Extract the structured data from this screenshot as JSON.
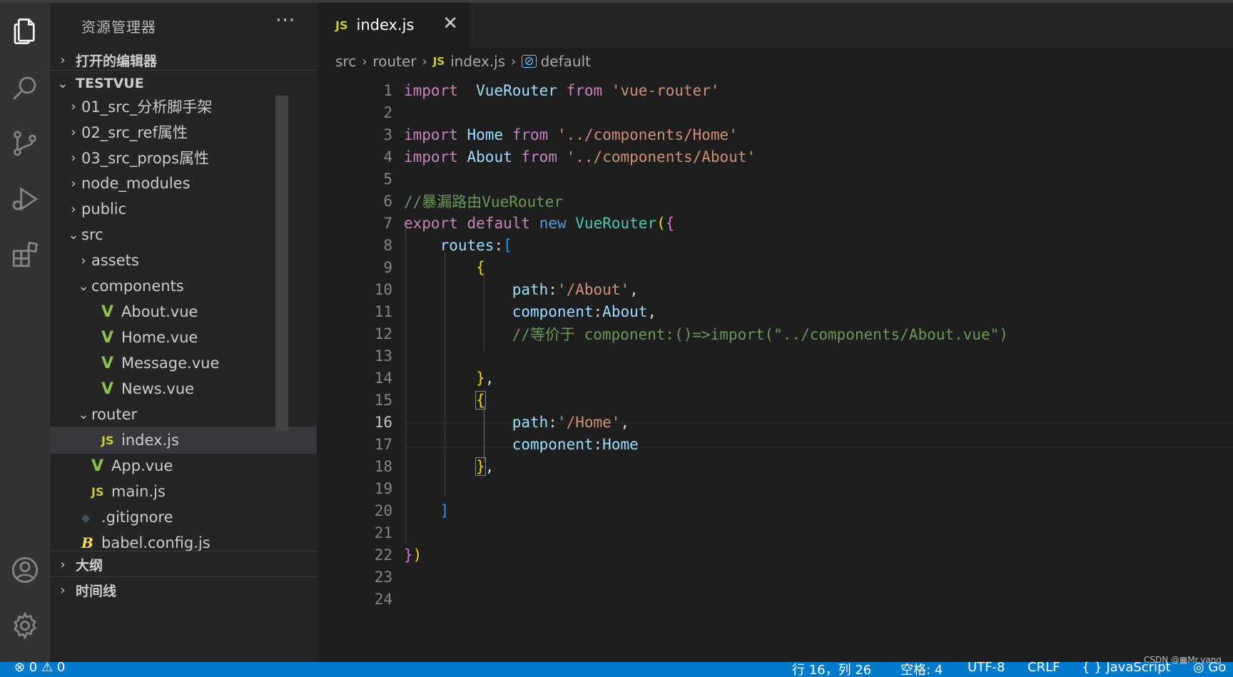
{
  "activity_bar": {
    "items": [
      "explorer-icon",
      "search-icon",
      "source-control-icon",
      "run-debug-icon",
      "extensions-icon"
    ],
    "bottom": [
      "account-icon",
      "settings-gear-icon"
    ]
  },
  "sidebar": {
    "title": "资源管理器",
    "more": "···",
    "open_editors": "打开的编辑器",
    "workspace": "TESTVUE",
    "tree": [
      {
        "label": "01_src_分析脚手架",
        "chev": "›",
        "icon": "",
        "depth": 0
      },
      {
        "label": "02_src_ref属性",
        "chev": "›",
        "icon": "",
        "depth": 0
      },
      {
        "label": "03_src_props属性",
        "chev": "›",
        "icon": "",
        "depth": 0
      },
      {
        "label": "node_modules",
        "chev": "›",
        "icon": "",
        "depth": 0
      },
      {
        "label": "public",
        "chev": "›",
        "icon": "",
        "depth": 0
      },
      {
        "label": "src",
        "chev": "⌄",
        "icon": "",
        "depth": 0
      },
      {
        "label": "assets",
        "chev": "›",
        "icon": "",
        "depth": 1
      },
      {
        "label": "components",
        "chev": "⌄",
        "icon": "",
        "depth": 1
      },
      {
        "label": "About.vue",
        "chev": "",
        "icon": "vue",
        "depth": 2
      },
      {
        "label": "Home.vue",
        "chev": "",
        "icon": "vue",
        "depth": 2
      },
      {
        "label": "Message.vue",
        "chev": "",
        "icon": "vue",
        "depth": 2
      },
      {
        "label": "News.vue",
        "chev": "",
        "icon": "vue",
        "depth": 2
      },
      {
        "label": "router",
        "chev": "⌄",
        "icon": "",
        "depth": 1
      },
      {
        "label": "index.js",
        "chev": "",
        "icon": "js",
        "depth": 2
      },
      {
        "label": "App.vue",
        "chev": "",
        "icon": "vue",
        "depth": 1
      },
      {
        "label": "main.js",
        "chev": "",
        "icon": "js",
        "depth": 1
      },
      {
        "label": ".gitignore",
        "chev": "",
        "icon": "git",
        "depth": 0
      },
      {
        "label": "babel.config.js",
        "chev": "",
        "icon": "babel",
        "depth": 0
      }
    ],
    "outline": "大纲",
    "timeline": "时间线",
    "icon_text": {
      "js": "JS",
      "vue": "V",
      "git": "◆",
      "babel": "B"
    }
  },
  "editor": {
    "tab": {
      "icon": "JS",
      "name": "index.js",
      "close": "✕"
    },
    "breadcrumb": {
      "src": "src",
      "router": "router",
      "js_icon": "JS",
      "file": "index.js",
      "symbol_icon": "⊘",
      "symbol": "default"
    },
    "lines": [
      "1",
      "2",
      "3",
      "4",
      "5",
      "6",
      "7",
      "8",
      "9",
      "10",
      "11",
      "12",
      "13",
      "14",
      "15",
      "16",
      "17",
      "18",
      "19",
      "20",
      "21",
      "22",
      "23",
      "24"
    ],
    "current_line": "16",
    "code": {
      "l1": [
        "import",
        "VueRouter",
        "from",
        "'vue-router'"
      ],
      "l3": [
        "import",
        "Home",
        "from",
        "'../components/Home'"
      ],
      "l4": [
        "import",
        "About",
        "from",
        "'../components/About'"
      ],
      "l6": "//暴漏路由VueRouter",
      "l7": [
        "export",
        "default",
        "new",
        "VueRouter",
        "(",
        "{"
      ],
      "l8": [
        "routes",
        ":",
        "["
      ],
      "l9": "{",
      "l10": [
        "path",
        ":",
        "'/About'",
        ","
      ],
      "l11": [
        "component",
        ":",
        "About",
        ","
      ],
      "l12": "//等价于 component:()=>import(\"../components/About.vue\")",
      "l14": [
        "}",
        ","
      ],
      "l15": "{",
      "l16": [
        "path",
        ":",
        "'/Home'",
        ","
      ],
      "l17": [
        "component",
        ":",
        "Home"
      ],
      "l18": [
        "}",
        ","
      ],
      "l20": "]",
      "l22": [
        "}",
        ")"
      ]
    }
  },
  "statusbar": {
    "errors": "⊗ 0 ⚠ 0",
    "position": "行 16，列 26",
    "spaces": "空格: 4",
    "encoding": "UTF-8",
    "eol": "CRLF",
    "language": "{ } JavaScript",
    "extra": "◎ Go"
  },
  "watermark": "CSDN @▦Mr.yang"
}
